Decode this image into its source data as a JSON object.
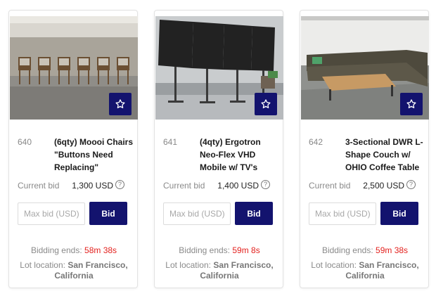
{
  "lots": [
    {
      "number": "640",
      "title": "(6qty) Moooi Chairs \"Buttons Need Replacing\"",
      "current_bid_label": "Current bid",
      "current_bid": "1,300 USD",
      "max_bid_placeholder": "Max bid (USD)",
      "bid_label": "Bid",
      "ends_label": "Bidding ends:",
      "ends_time": "58m 38s",
      "location_label": "Lot location:",
      "location": "San Francisco, California",
      "image_alt": "Row of six wooden chairs against a wall"
    },
    {
      "number": "641",
      "title": "(4qty) Ergotron Neo-Flex VHD Mobile w/ TV's",
      "current_bid_label": "Current bid",
      "current_bid": "1,400 USD",
      "max_bid_placeholder": "Max bid (USD)",
      "bid_label": "Bid",
      "ends_label": "Bidding ends:",
      "ends_time": "59m 8s",
      "location_label": "Lot location:",
      "location": "San Francisco, California",
      "image_alt": "Four mobile TV stands with screens"
    },
    {
      "number": "642",
      "title": "3-Sectional DWR L-Shape Couch w/ OHIO Coffee Table",
      "current_bid_label": "Current bid",
      "current_bid": "2,500 USD",
      "max_bid_placeholder": "Max bid (USD)",
      "bid_label": "Bid",
      "ends_label": "Bidding ends:",
      "ends_time": "59m 38s",
      "location_label": "Lot location:",
      "location": "San Francisco, California",
      "image_alt": "Grey L-shaped sectional couch with wooden coffee table"
    }
  ],
  "icons": {
    "watch": "star-outline-icon",
    "help": "question-circle-icon"
  },
  "colors": {
    "accent": "#13136e",
    "timer": "#e3211e",
    "muted": "#8a8a8a"
  }
}
